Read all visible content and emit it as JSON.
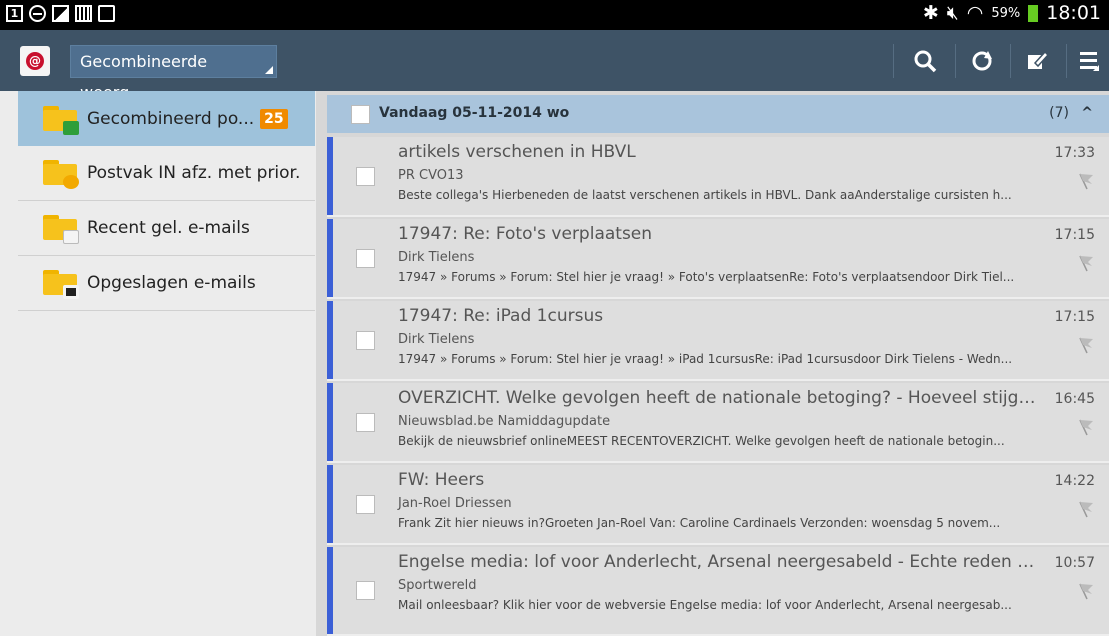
{
  "status_bar": {
    "battery": "59%",
    "time": "18:01"
  },
  "action_bar": {
    "account": "Gecombineerde weerg...",
    "icons": [
      "search-icon",
      "refresh-icon",
      "compose-icon",
      "menu-icon"
    ]
  },
  "sidebar": {
    "folders": [
      {
        "label": "Gecombineerd po...",
        "count": "25",
        "icon": "inbox-folder-icon"
      },
      {
        "label": "Postvak IN afz. met prior.",
        "icon": "priority-folder-icon"
      },
      {
        "label": "Recent gel. e-mails",
        "icon": "recent-folder-icon"
      },
      {
        "label": "Opgeslagen e-mails",
        "icon": "saved-folder-icon"
      }
    ]
  },
  "list": {
    "group_header": {
      "title": "Vandaag  05-11-2014 wo",
      "count": "(7)"
    },
    "emails": [
      {
        "subject": "artikels verschenen in HBVL",
        "time": "17:33",
        "sender": "PR CVO13",
        "preview": "Beste collega's Hierbeneden de laatst verschenen artikels in HBVL. Dank aaAnderstalige cursisten h..."
      },
      {
        "subject": "17947: Re: Foto's verplaatsen",
        "time": "17:15",
        "sender": "Dirk Tielens",
        "preview": "17947 » Forums » Forum: Stel hier je vraag! » Foto's verplaatsenRe: Foto's verplaatsendoor Dirk Tiel..."
      },
      {
        "subject": "17947: Re: iPad 1cursus",
        "time": "17:15",
        "sender": "Dirk Tielens",
        "preview": "17947 » Forums » Forum: Stel hier je vraag! » iPad 1cursusRe: iPad 1cursusdoor Dirk Tielens - Wedn..."
      },
      {
        "subject": "OVERZICHT. Welke gevolgen heeft de nationale betoging?  - Hoeveel stijgt...",
        "time": "16:45",
        "sender": "Nieuwsblad.be Namiddagupdate",
        "preview": "Bekijk de nieuwsbrief onlineMEEST RECENTOVERZICHT. Welke gevolgen heeft de nationale betogin..."
      },
      {
        "subject": "FW: Heers",
        "time": "14:22",
        "sender": "Jan-Roel Driessen",
        "preview": "Frank Zit hier nieuws in?Groeten Jan-Roel Van: Caroline Cardinaels Verzonden: woensdag 5 novem..."
      },
      {
        "subject": "Engelse media: lof voor Anderlecht, Arsenal neergesabeld - Echte reden a...",
        "time": "10:57",
        "sender": "Sportwereld",
        "preview": "Mail onleesbaar? Klik hier voor de webversie Engelse media: lof voor Anderlecht, Arsenal neergesab..."
      }
    ]
  }
}
